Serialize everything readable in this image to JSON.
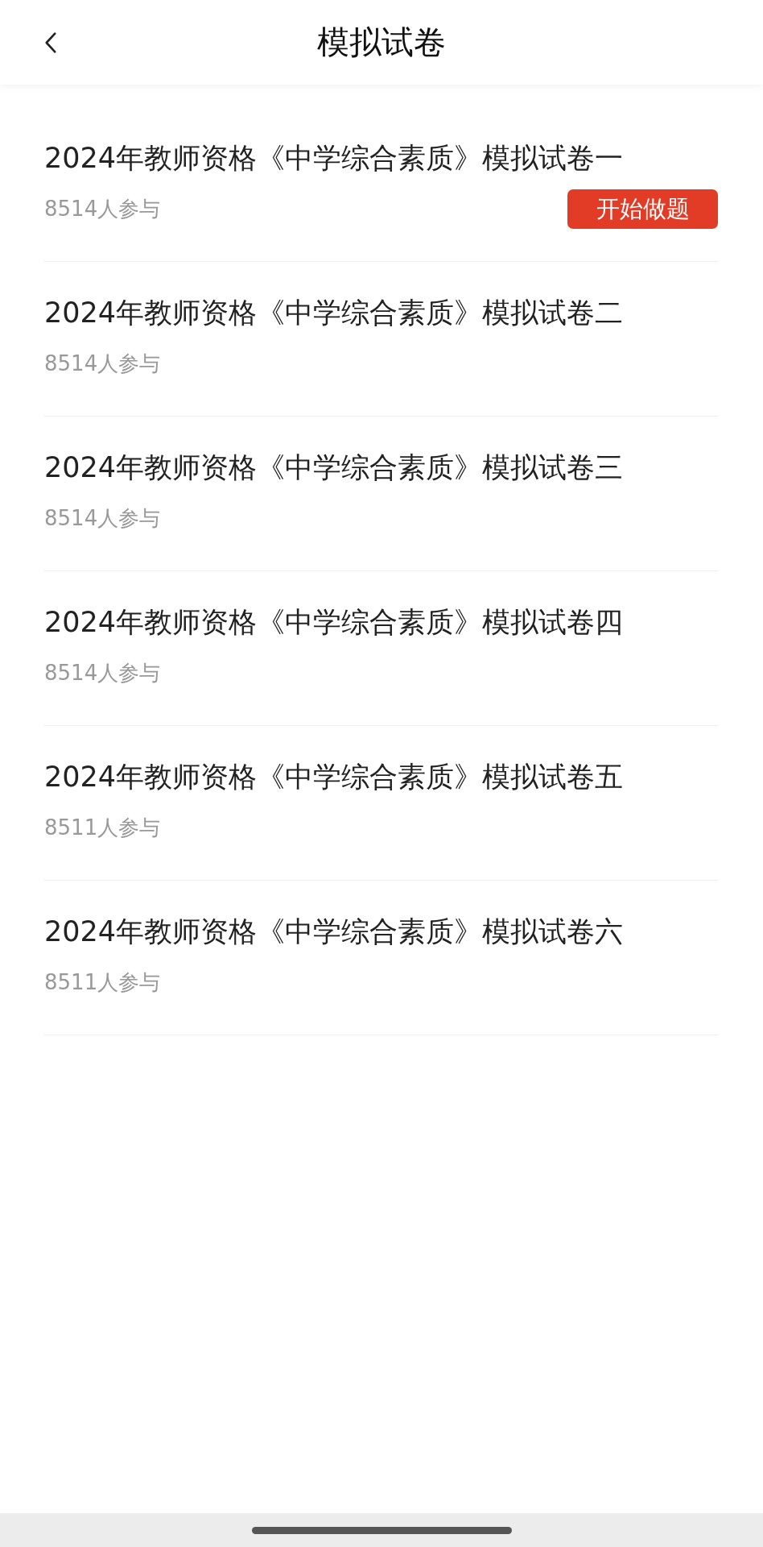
{
  "header": {
    "title": "模拟试卷"
  },
  "papers": [
    {
      "title": "2024年教师资格《中学综合素质》模拟试卷一",
      "participants": "8514人参与",
      "action": "开始做题"
    },
    {
      "title": "2024年教师资格《中学综合素质》模拟试卷二",
      "participants": "8514人参与"
    },
    {
      "title": "2024年教师资格《中学综合素质》模拟试卷三",
      "participants": "8514人参与"
    },
    {
      "title": "2024年教师资格《中学综合素质》模拟试卷四",
      "participants": "8514人参与"
    },
    {
      "title": "2024年教师资格《中学综合素质》模拟试卷五",
      "participants": "8511人参与"
    },
    {
      "title": "2024年教师资格《中学综合素质》模拟试卷六",
      "participants": "8511人参与"
    }
  ]
}
